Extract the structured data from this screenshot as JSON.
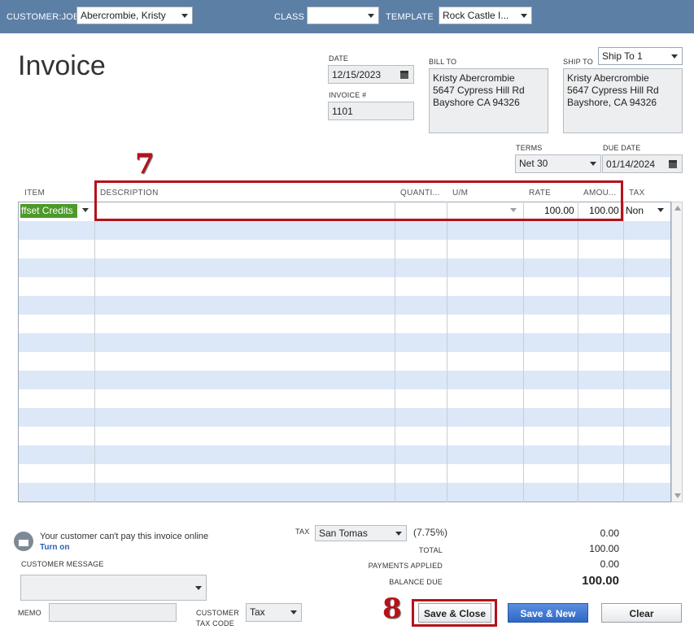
{
  "topbar": {
    "customer_job_label": "CUSTOMER:JOB",
    "customer_job_value": "Abercrombie, Kristy",
    "class_label": "CLASS",
    "class_value": "",
    "template_label": "TEMPLATE",
    "template_value": "Rock Castle I..."
  },
  "form": {
    "title": "Invoice",
    "date_label": "DATE",
    "date_value": "12/15/2023",
    "invoice_no_label": "INVOICE #",
    "invoice_no_value": "1101",
    "bill_to_label": "BILL TO",
    "bill_to_lines": [
      "Kristy Abercrombie",
      "5647 Cypress Hill Rd",
      "Bayshore CA 94326"
    ],
    "ship_to_label": "SHIP TO",
    "ship_to_select": "Ship To 1",
    "ship_to_lines": [
      "Kristy Abercrombie",
      "5647 Cypress Hill Rd",
      "Bayshore, CA 94326"
    ],
    "terms_label": "TERMS",
    "terms_value": "Net 30",
    "due_date_label": "DUE DATE",
    "due_date_value": "01/14/2024"
  },
  "table": {
    "columns": [
      "ITEM",
      "DESCRIPTION",
      "QUANTI...",
      "U/M",
      "RATE",
      "AMOU...",
      "TAX"
    ],
    "rows": [
      {
        "item": "ffset Credits",
        "description": "",
        "quantity": "",
        "um": "",
        "rate": "100.00",
        "amount": "100.00",
        "tax": "Non"
      }
    ]
  },
  "annotations": {
    "step7": "7",
    "step8": "8"
  },
  "footer": {
    "online_pay_text": "Your customer can't pay this invoice online",
    "turn_on_link": "Turn on",
    "customer_message_label": "CUSTOMER MESSAGE",
    "memo_label": "MEMO",
    "customer_tax_code_label_1": "CUSTOMER",
    "customer_tax_code_label_2": "TAX CODE",
    "customer_tax_code_value": "Tax",
    "tax_label": "TAX",
    "tax_item_value": "San Tomas",
    "tax_rate": "(7.75%)",
    "tax_amount": "0.00",
    "total_label": "TOTAL",
    "total_value": "100.00",
    "payments_applied_label": "PAYMENTS APPLIED",
    "payments_applied_value": "0.00",
    "balance_due_label": "BALANCE DUE",
    "balance_due_value": "100.00"
  },
  "buttons": {
    "save_close": "Save & Close",
    "save_new": "Save & New",
    "clear": "Clear"
  },
  "colors": {
    "topbar": "#5c7fa6",
    "highlight": "#b5121b",
    "row_stripe": "#dce8f8",
    "item_cell": "#4c9a2a"
  }
}
